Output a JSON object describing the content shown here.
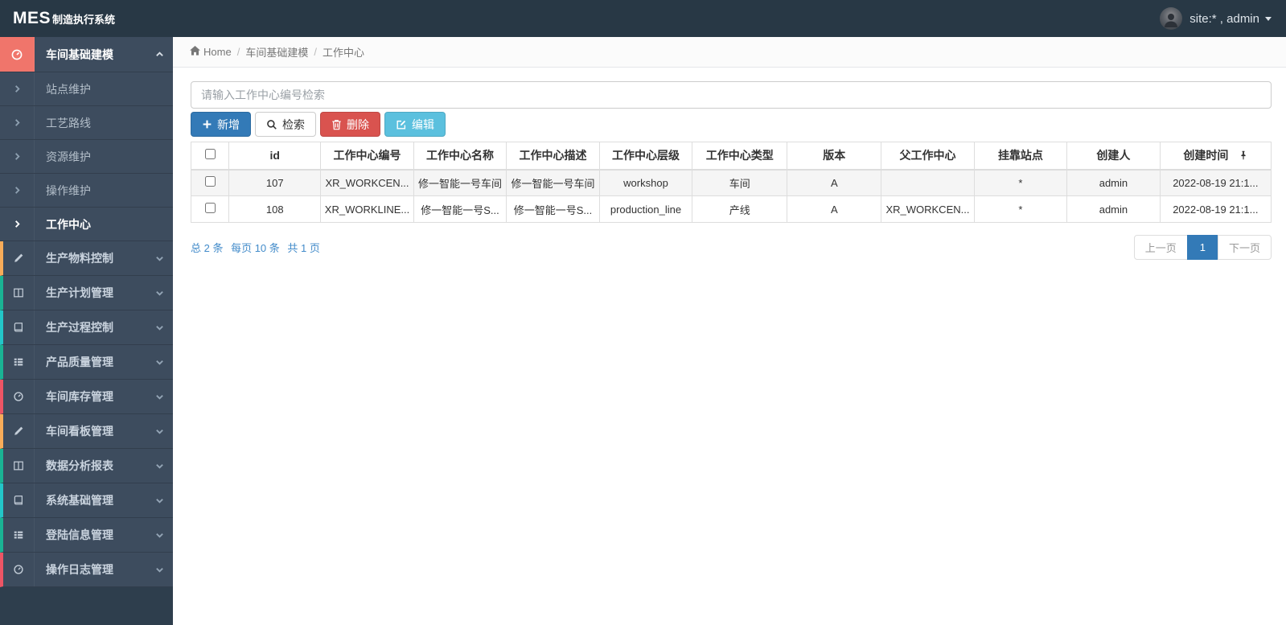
{
  "topbar": {
    "logo_bold": "MES",
    "logo_suffix": "制造执行系统",
    "user_label": "site:* , admin"
  },
  "breadcrumb": {
    "home": "Home",
    "separator": "/",
    "level1": "车间基础建模",
    "level2": "工作中心"
  },
  "sidebar": {
    "active_group": {
      "label": "车间基础建模",
      "icon": "tachometer-icon",
      "accent": "#f0756b"
    },
    "submenu": [
      {
        "label": "站点维护"
      },
      {
        "label": "工艺路线"
      },
      {
        "label": "资源维护"
      },
      {
        "label": "操作维护"
      },
      {
        "label": "工作中心"
      }
    ],
    "active_submenu": "工作中心",
    "groups": [
      {
        "label": "生产物料控制",
        "icon": "pencil-icon",
        "accent": "#f8ac59"
      },
      {
        "label": "生产计划管理",
        "icon": "columns-icon",
        "accent": "#1ab394"
      },
      {
        "label": "生产过程控制",
        "icon": "book-icon",
        "accent": "#23c6c8"
      },
      {
        "label": "产品质量管理",
        "icon": "list-icon",
        "accent": "#1ab394"
      },
      {
        "label": "车间库存管理",
        "icon": "tachometer-icon",
        "accent": "#ed5565"
      },
      {
        "label": "车间看板管理",
        "icon": "pencil-icon",
        "accent": "#f8ac59"
      },
      {
        "label": "数据分析报表",
        "icon": "columns-icon",
        "accent": "#1ab394"
      },
      {
        "label": "系统基础管理",
        "icon": "book-icon",
        "accent": "#23c6c8"
      },
      {
        "label": "登陆信息管理",
        "icon": "list-icon",
        "accent": "#1ab394"
      },
      {
        "label": "操作日志管理",
        "icon": "tachometer-icon",
        "accent": "#ed5565"
      }
    ]
  },
  "search": {
    "placeholder": "请输入工作中心编号检索"
  },
  "toolbar": {
    "add": "新增",
    "search": "检索",
    "delete": "删除",
    "edit": "编辑",
    "colors": {
      "add": "#337ab7",
      "delete": "#d9534f",
      "edit": "#5bc0de"
    }
  },
  "table": {
    "headers": [
      "id",
      "工作中心编号",
      "工作中心名称",
      "工作中心描述",
      "工作中心层级",
      "工作中心类型",
      "版本",
      "父工作中心",
      "挂靠站点",
      "创建人",
      "创建时间"
    ],
    "rows": [
      {
        "id": "107",
        "code": "XR_WORKCEN...",
        "name": "修一智能一号车间",
        "desc": "修一智能一号车间",
        "level": "workshop",
        "type": "车间",
        "version": "A",
        "parent": "",
        "station": "*",
        "creator": "admin",
        "created": "2022-08-19 21:1..."
      },
      {
        "id": "108",
        "code": "XR_WORKLINE...",
        "name": "修一智能一号S...",
        "desc": "修一智能一号S...",
        "level": "production_line",
        "type": "产线",
        "version": "A",
        "parent": "XR_WORKCEN...",
        "station": "*",
        "creator": "admin",
        "created": "2022-08-19 21:1..."
      }
    ]
  },
  "pagination": {
    "summary_total": "总 2 条",
    "summary_per": "每页 10 条",
    "summary_pages": "共 1 页",
    "prev": "上一页",
    "page": "1",
    "next": "下一页",
    "active_color": "#337ab7"
  }
}
